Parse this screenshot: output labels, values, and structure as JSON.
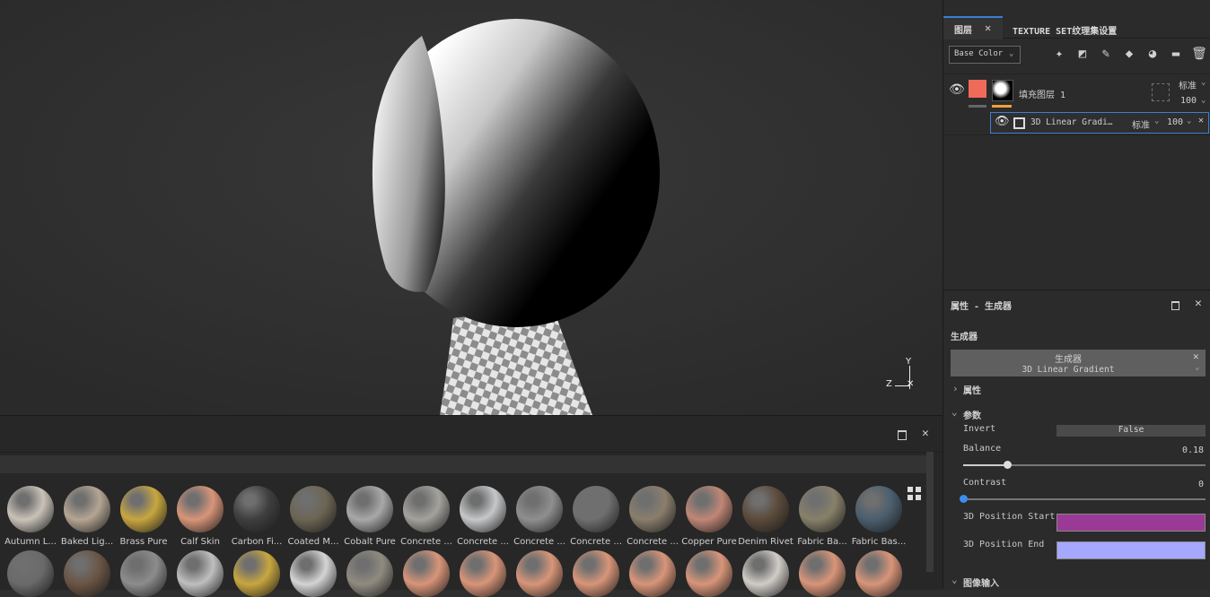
{
  "layers_panel": {
    "tab_layers": "图层",
    "tab_texture_set": "TEXTURE SET纹理集设置",
    "channel_select": "Base Color",
    "layer": {
      "name": "填充图层 1",
      "blend": "标准",
      "opacity": "100"
    },
    "effect": {
      "name": "3D Linear Gradi…",
      "blend": "标准",
      "opacity": "100"
    }
  },
  "properties_panel": {
    "title": "属性 - 生成器",
    "section_generator": "生成器",
    "generator_label": "生成器",
    "generator_value": "3D Linear Gradient",
    "section_attributes": "属性",
    "section_params": "参数",
    "invert_label": "Invert",
    "invert_value": "False",
    "balance_label": "Balance",
    "balance_value": "0.18",
    "balance_fraction": 0.18,
    "contrast_label": "Contrast",
    "contrast_value": "0",
    "contrast_fraction": 0.0,
    "pos_start_label": "3D Position Start",
    "pos_start_color": "#9a3a96",
    "pos_end_label": "3D Position End",
    "pos_end_color": "#a6a8ff",
    "section_image_input": "图像输入"
  },
  "axis_gizmo": {
    "y": "Y",
    "z": "Z"
  },
  "shelf": {
    "materials": [
      {
        "label": "Autumn L...",
        "color": "#c9c2b8"
      },
      {
        "label": "Baked Lig...",
        "color": "#b5a593"
      },
      {
        "label": "Brass Pure",
        "color": "#c8a640"
      },
      {
        "label": "Calf Skin",
        "color": "#d89579"
      },
      {
        "label": "Carbon Fi...",
        "color": "#3e3e3e"
      },
      {
        "label": "Coated M...",
        "color": "#6c6554"
      },
      {
        "label": "Cobalt Pure",
        "color": "#a8a8a8"
      },
      {
        "label": "Concrete ...",
        "color": "#a4a29d"
      },
      {
        "label": "Concrete ...",
        "color": "#c5c7c9"
      },
      {
        "label": "Concrete ...",
        "color": "#8f8f8f"
      },
      {
        "label": "Concrete ...",
        "color": "#6f6f6f"
      },
      {
        "label": "Concrete ...",
        "color": "#8a7e6c"
      },
      {
        "label": "Copper Pure",
        "color": "#c08676"
      },
      {
        "label": "Denim Rivet",
        "color": "#5a4a3a"
      },
      {
        "label": "Fabric Ba...",
        "color": "#878069"
      },
      {
        "label": "Fabric Bas...",
        "color": "#4a5e6e"
      }
    ],
    "row2_colors": [
      "#6a6a6a",
      "#6a5444",
      "#8c8c8c",
      "#bfbfbf",
      "#c8a640",
      "#d4d4d4",
      "#8f8b80",
      "#d89579",
      "#d89579",
      "#d89579",
      "#d89579",
      "#d89579",
      "#d89579",
      "#d0ccc6",
      "#d89579",
      "#d89579"
    ]
  }
}
